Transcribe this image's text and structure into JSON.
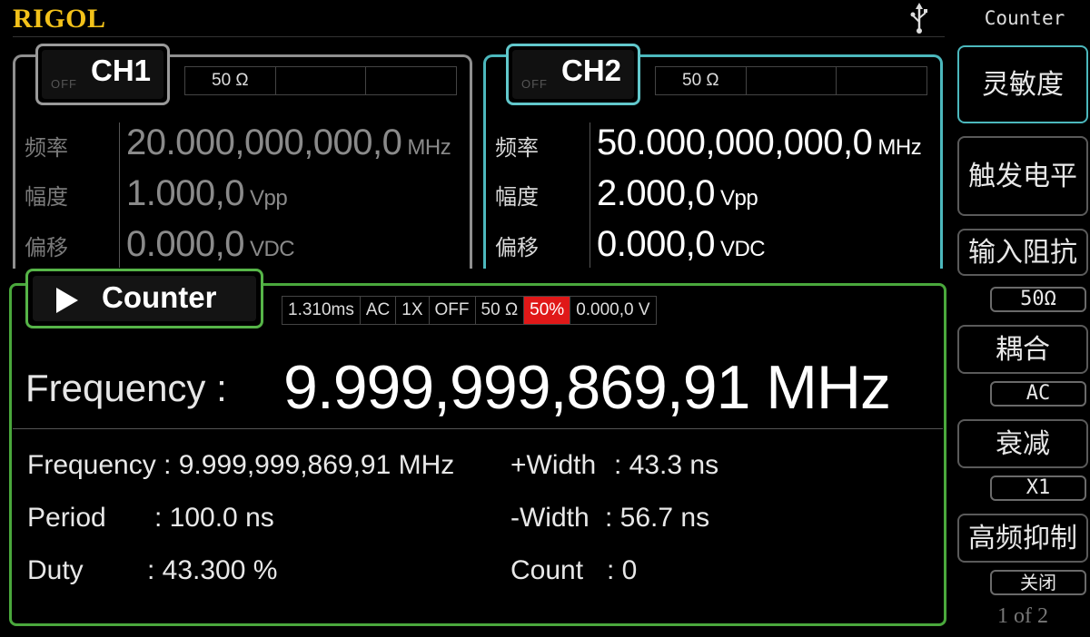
{
  "header": {
    "logo": "RIGOL",
    "mode_title": "Counter"
  },
  "ch1": {
    "name": "CH1",
    "state": "OFF",
    "impedance": "50 Ω",
    "params": [
      {
        "label": "频率",
        "value": "20.000,000,000,0",
        "unit": "MHz"
      },
      {
        "label": "幅度",
        "value": "1.000,0",
        "unit": "Vpp"
      },
      {
        "label": "偏移",
        "value": "0.000,0",
        "unit": "VDC"
      }
    ]
  },
  "ch2": {
    "name": "CH2",
    "state": "OFF",
    "impedance": "50 Ω",
    "params": [
      {
        "label": "频率",
        "value": "50.000,000,000,0",
        "unit": "MHz"
      },
      {
        "label": "幅度",
        "value": "2.000,0",
        "unit": "Vpp"
      },
      {
        "label": "偏移",
        "value": "0.000,0",
        "unit": "VDC"
      }
    ]
  },
  "counter": {
    "name": "Counter",
    "status": [
      "1.310ms",
      "AC",
      "1X",
      "OFF",
      "50 Ω",
      "50%",
      "0.000,0 V"
    ],
    "highlight_color": "#e01818",
    "big_label": "Frequency :",
    "big_value": "9.999,999,869,91 MHz",
    "stats_left": [
      {
        "text": "Frequency : 9.999,999,869,91 MHz"
      },
      {
        "label": "Period",
        "value": ":  100.0 ns"
      },
      {
        "label": "Duty",
        "value": ":  43.300 %"
      }
    ],
    "stats_right": [
      {
        "label": "+Width",
        "value": ":    43.3 ns"
      },
      {
        "label": "-Width",
        "value": ":    56.7 ns"
      },
      {
        "label": "Count",
        "value": ":    0"
      }
    ]
  },
  "softkeys": {
    "sensitivity": "灵敏度",
    "trigger_level": "触发电平",
    "impedance": "输入阻抗",
    "impedance_value": "50Ω",
    "coupling": "耦合",
    "coupling_value": "AC",
    "attenuation": "衰减",
    "attenuation_value": "X1",
    "hf_reject": "高频抑制",
    "hf_reject_value": "关闭",
    "page": "1 of 2"
  },
  "colors": {
    "logo": "#f3c21a",
    "ch1_border": "#8f8f8f",
    "ch2_border": "#4cb8bd",
    "counter_border": "#4aa83c"
  },
  "icons": [
    "usb-icon",
    "play-icon"
  ]
}
